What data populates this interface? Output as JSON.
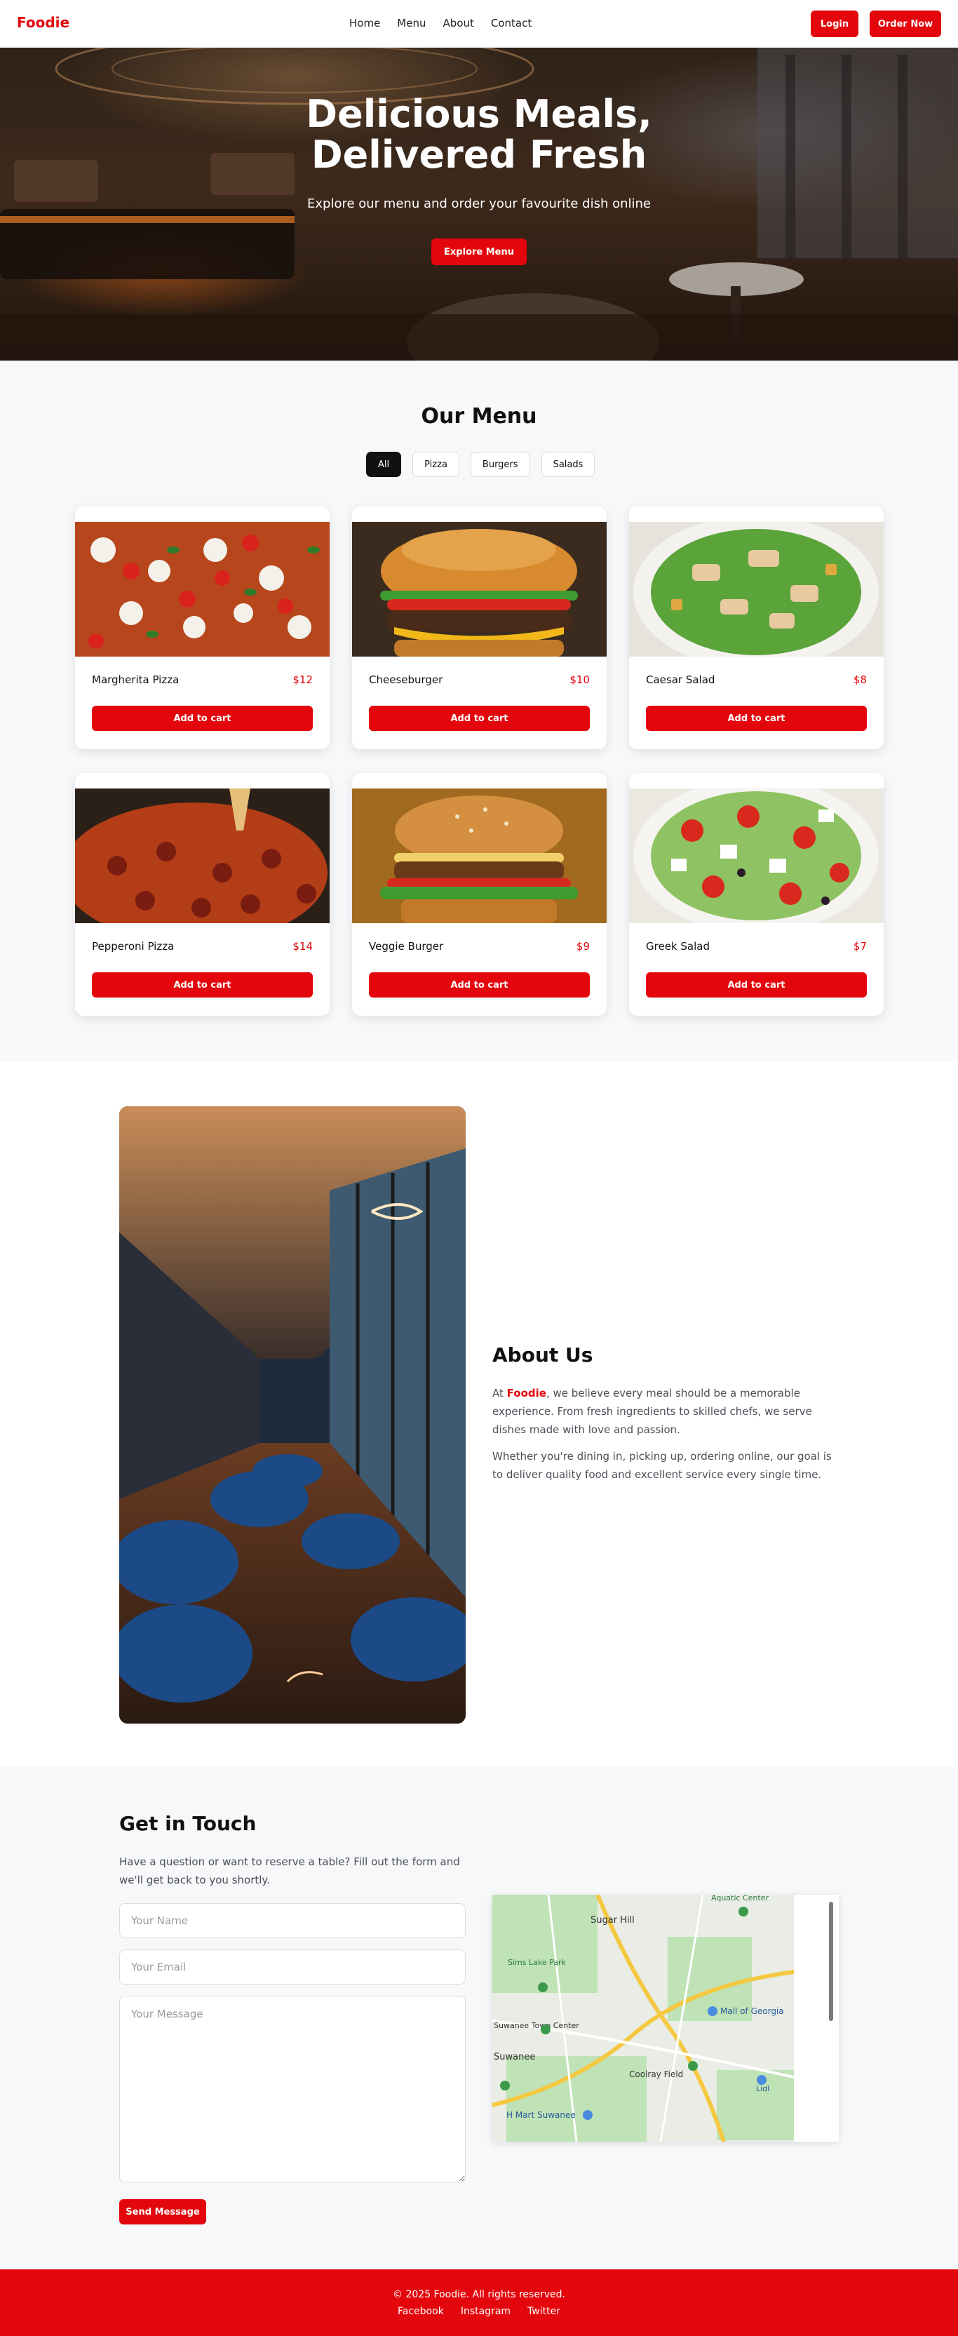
{
  "brand": {
    "name": "Foodie",
    "accent": "#e3060c"
  },
  "nav": {
    "links": [
      "Home",
      "Menu",
      "About",
      "Contact"
    ],
    "login_label": "Login",
    "order_label": "Order Now"
  },
  "hero": {
    "title_line1": "Delicious Meals,",
    "title_line2": "Delivered Fresh",
    "subtitle": "Explore our menu and order your favourite dish online",
    "button_label": "Explore Menu"
  },
  "menu": {
    "title": "Our Menu",
    "filters": [
      "All",
      "Pizza",
      "Burgers",
      "Salads"
    ],
    "active_filter": "All",
    "add_label": "Add to cart",
    "items": [
      {
        "name": "Margherita Pizza",
        "price": "$12",
        "image": "pizza-photo"
      },
      {
        "name": "Cheeseburger",
        "price": "$10",
        "image": "burger-photo"
      },
      {
        "name": "Caesar Salad",
        "price": "$8",
        "image": "salad-photo"
      },
      {
        "name": "Pepperoni Pizza",
        "price": "$14",
        "image": "pizza-photo"
      },
      {
        "name": "Veggie Burger",
        "price": "$9",
        "image": "burger-photo"
      },
      {
        "name": "Greek Salad",
        "price": "$7",
        "image": "salad-photo"
      }
    ]
  },
  "about": {
    "title": "About Us",
    "p1_prefix": "At ",
    "p1_brand": "Foodie",
    "p1_rest": ", we believe every meal should be a memorable experience. From fresh ingredients to skilled chefs, we serve dishes made with love and passion.",
    "p2": "Whether you're dining in, picking up, ordering online, our goal is to deliver quality food and excellent service every single time."
  },
  "contact": {
    "title": "Get in Touch",
    "description": "Have a question or want to reserve a table? Fill out the form and we'll get back to you shortly.",
    "name_placeholder": "Your Name",
    "email_placeholder": "Your Email",
    "message_placeholder": "Your Message",
    "send_label": "Send Message",
    "map_labels": [
      "Sugar Hill",
      "Sims Lake Park",
      "Suwanee Town Center",
      "Suwanee",
      "Coolray Field",
      "Mall of Georgia",
      "H Mart Suwanee",
      "Aquatic Center",
      "Lidl"
    ]
  },
  "footer": {
    "copyright": "© 2025 Foodie. All rights reserved.",
    "links": [
      "Facebook",
      "Instagram",
      "Twitter"
    ]
  }
}
